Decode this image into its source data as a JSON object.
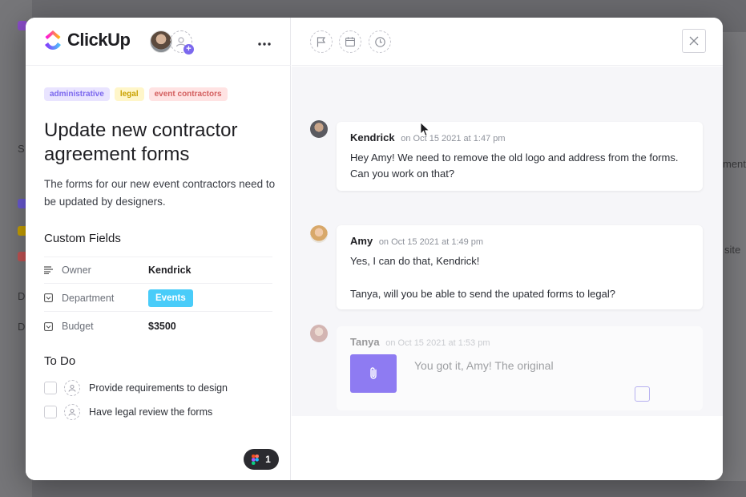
{
  "app": {
    "name": "ClickUp"
  },
  "backdrop": {
    "sidebar_letters": [
      "S",
      "D",
      "D"
    ],
    "right_snippets": [
      "ment",
      "site"
    ]
  },
  "task": {
    "tags": [
      {
        "label": "administrative",
        "color": "#7b68ee"
      },
      {
        "label": "legal",
        "color": "#c9a100"
      },
      {
        "label": "event contractors",
        "color": "#d35e5e"
      }
    ],
    "title": "Update new contractor agreement forms",
    "description": "The forms for our new event contractors need to be updated by designers.",
    "custom_fields": {
      "heading": "Custom Fields",
      "rows": [
        {
          "icon": "lines-icon",
          "label": "Owner",
          "value": "Kendrick"
        },
        {
          "icon": "dropdown-icon",
          "label": "Department",
          "value": "Events",
          "badge_color": "#49ccf9"
        },
        {
          "icon": "dropdown-icon",
          "label": "Budget",
          "value": "$3500"
        }
      ]
    },
    "todo": {
      "heading": "To Do",
      "items": [
        {
          "label": "Provide requirements to design",
          "checked": false
        },
        {
          "label": "Have legal review the forms",
          "checked": false
        }
      ]
    },
    "figma_count": "1"
  },
  "header_actions": [
    "flag-icon",
    "calendar-icon",
    "clock-icon",
    "close-icon"
  ],
  "comments": [
    {
      "author": "Kendrick",
      "time": "on Oct 15 2021 at 1:47 pm",
      "body": [
        "Hey Amy! We need to remove the old logo and address from the forms. Can you work on that?"
      ]
    },
    {
      "author": "Amy",
      "time": "on Oct 15 2021 at 1:49 pm",
      "body": [
        "Yes, I can do that, Kendrick!",
        "Tanya, will you be able to send the upated forms to legal?"
      ]
    },
    {
      "author": "Tanya",
      "time": "on Oct 15 2021 at 1:53 pm",
      "body": [
        "You got it, Amy! The original"
      ]
    }
  ]
}
